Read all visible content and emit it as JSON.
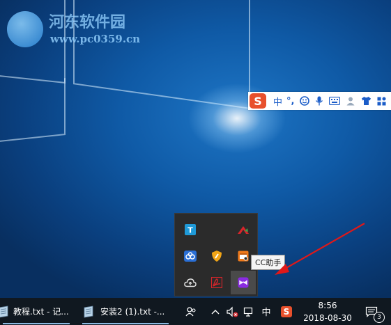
{
  "watermark": {
    "title": "河东软件园",
    "url": "www.pc0359.cn"
  },
  "ime_bar": {
    "logo": "S",
    "mode": "中",
    "punct": "°,"
  },
  "tray_overflow": {
    "icons": [
      "text-tool-icon",
      "red-arrow-app-icon",
      "cloud-sync-icon",
      "security-shield-icon",
      "window-app-icon",
      "upload-cloud-icon",
      "pdf-app-icon",
      "cc-helper-icon"
    ],
    "tooltip": "CC助手"
  },
  "taskbar": {
    "apps": [
      {
        "label": "教程.txt - 记..."
      },
      {
        "label": "安装2 (1).txt -..."
      }
    ],
    "input_lang": "中",
    "ime_logo": "S",
    "time": "8:56",
    "date": "2018-08-30",
    "notification_count": "3"
  },
  "colors": {
    "desktop": "#0f5aa6",
    "taskbar": "#101820",
    "ime_accent": "#1a5cc8",
    "sogou": "#e8502c",
    "arrow": "#e01818"
  }
}
